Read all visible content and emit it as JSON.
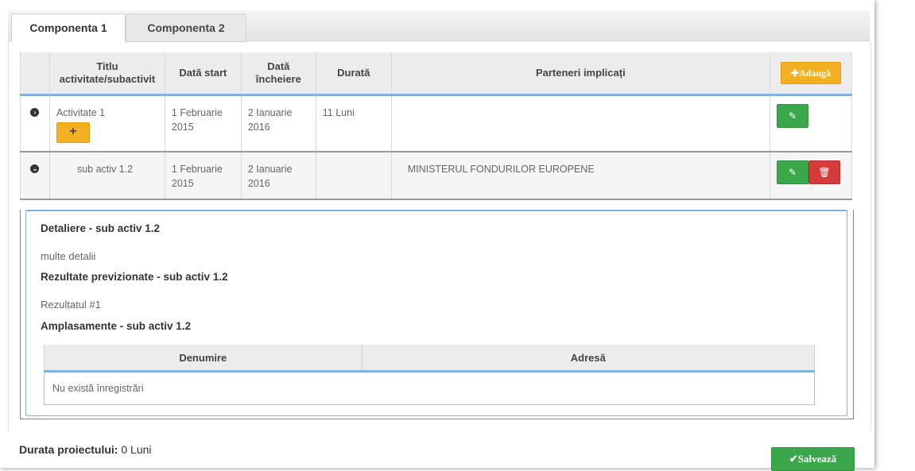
{
  "tabs": [
    {
      "label": "Componenta 1",
      "active": true
    },
    {
      "label": "Componenta 2",
      "active": false
    }
  ],
  "table": {
    "headers": {
      "title": "Titlu activitate/subactivit",
      "start": "Dată start",
      "end": "Dată încheiere",
      "duration": "Durată",
      "partners": "Parteneri implicați",
      "add_button": "✚Adaugă"
    },
    "rows": [
      {
        "toggle_icon": "chevron-right-circle-icon",
        "title": "Activitate 1",
        "start": "1 Februarie 2015",
        "end": "2 Ianuarie 2016",
        "duration": "11 Luni",
        "partners": ""
      },
      {
        "toggle_icon": "chevron-down-circle-icon",
        "title": "sub activ 1.2",
        "start": "1 Februarie 2015",
        "end": "2 Ianuarie 2016",
        "duration": "",
        "partners": "MINISTERUL FONDURILOR EUROPENE"
      }
    ]
  },
  "detail": {
    "detaliere_heading": "Detaliere - sub activ 1.2",
    "detaliere_text": "multe detalii",
    "rezultate_heading": "Rezultate previzionate - sub activ 1.2",
    "rezultate_text": "Rezultatul #1",
    "amplasamente_heading": "Amplasamente - sub activ 1.2",
    "sub_table": {
      "col_name": "Denumire",
      "col_address": "Adresă",
      "empty": "Nu există înregistrări"
    }
  },
  "footer": {
    "duration_label": "Durata proiectului:",
    "duration_value": "0 Luni",
    "save_button": "✔Salvează"
  },
  "colors": {
    "accent_blue": "#7fb2dc",
    "add_orange": "#f3b022",
    "edit_green": "#3aa84a",
    "delete_red": "#d73a3a"
  }
}
